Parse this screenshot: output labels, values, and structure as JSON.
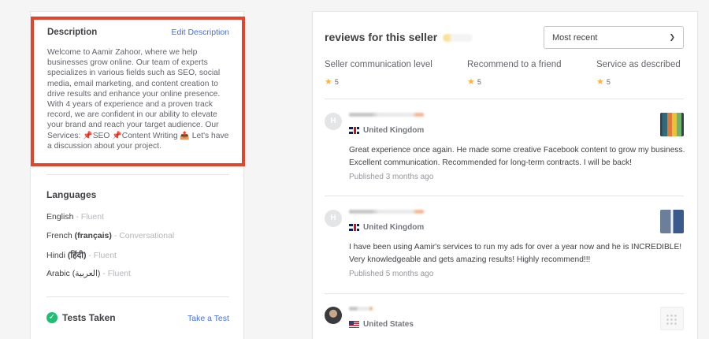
{
  "description": {
    "title": "Description",
    "edit_label": "Edit Description",
    "text_before": "Welcome to Aamir Zahoor, where we help businesses grow online. Our team of experts specializes in various fields such as SEO, social media, email marketing, and content creation to drive results and enhance your online presence. With 4 years of experience and a proven track record, we are confident in our ability to elevate your brand and reach your target audience. Our Services:",
    "service_1": "SEO",
    "service_2": "Content Writing",
    "text_after": "Let's have a discussion about your project.",
    "service_icon": "pushpin-icon",
    "cta_icon": "outbox-tray-icon"
  },
  "languages": {
    "title": "Languages",
    "items": [
      {
        "name": "English",
        "native": "",
        "level": "Fluent"
      },
      {
        "name": "French",
        "native": "(français)",
        "level": "Conversational"
      },
      {
        "name": "Hindi",
        "native": "(हिंदी)",
        "level": "Fluent"
      },
      {
        "name": "Arabic",
        "native": "(العربية)",
        "level": "Fluent"
      }
    ]
  },
  "tests": {
    "title": "Tests Taken",
    "take_label": "Take a Test"
  },
  "reviews": {
    "title": "reviews for this seller",
    "sort": {
      "selected": "Most recent"
    },
    "metrics": [
      {
        "label": "Seller communication level",
        "score": "5"
      },
      {
        "label": "Recommend to a friend",
        "score": "5"
      },
      {
        "label": "Service as described",
        "score": "5"
      }
    ],
    "items": [
      {
        "avatar_initial": "H",
        "country": "United Kingdom",
        "text": "Great experience once again. He made some creative Facebook content to grow my business. Excellent communication. Recommended for long-term contracts. I will be back!",
        "published": "Published 3 months ago"
      },
      {
        "avatar_initial": "H",
        "country": "United Kingdom",
        "text": "I have been using Aamir's services to run my ads for over a year now and he is INCREDIBLE! Very knowledgeable and gets amazing results! Highly recommend!!!",
        "published": "Published 5 months ago"
      },
      {
        "avatar_initial": "",
        "country": "United States",
        "text": "",
        "published": ""
      }
    ]
  },
  "colors": {
    "highlight_border": "#e2452c",
    "link": "#446ee7",
    "star": "#ffb33e",
    "success": "#1dbf73"
  }
}
